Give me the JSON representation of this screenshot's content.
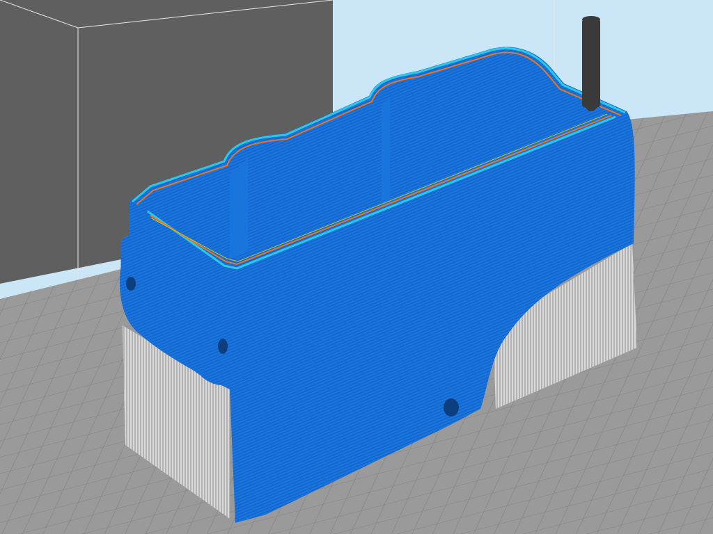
{
  "app": {
    "view": "layer-preview"
  },
  "scene": {
    "sky_color": "#cbe6f6",
    "build_volume_wall_color": "#5f5f5f",
    "build_plate_color": "#9a9a9a",
    "grid_line_color": "#7d7d7d",
    "model_color": "#1a74de",
    "model_layer_line_color": "#0f5fc2",
    "support_color": "#d8d8d8",
    "support_line_color": "#8e8e8e",
    "outer_wall_color": "#2bc8e8",
    "inner_wall_color": "#f0741a",
    "infill_color": "#c7c21c",
    "nozzle_color": "#3a3a3a"
  },
  "objects": [
    {
      "name": "printed-enclosure",
      "icon": "model-shell"
    },
    {
      "name": "support-structure",
      "icon": "support-lattice"
    },
    {
      "name": "print-nozzle",
      "icon": "nozzle"
    }
  ]
}
